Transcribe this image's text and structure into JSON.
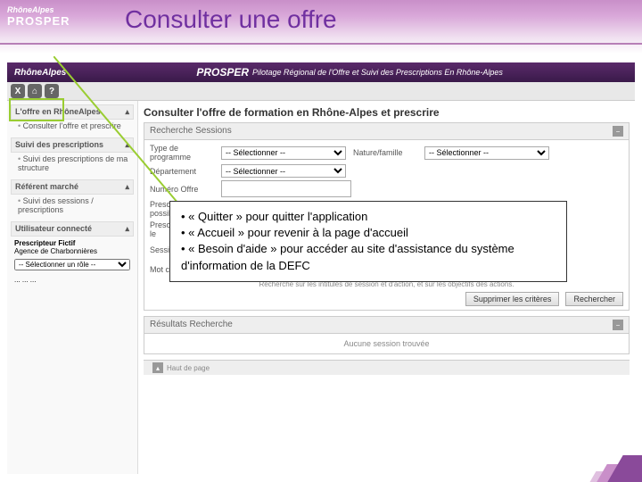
{
  "slide": {
    "brand_region": "RhôneAlpes",
    "brand_app": "PROSPER",
    "title": "Consulter une offre"
  },
  "app": {
    "header_region": "RhôneAlpes",
    "header_app": "PROSPER",
    "header_tagline": "Pilotage Régional de l'Offre et Suivi des Prescriptions En Rhône-Alpes",
    "topbuttons": {
      "quit": "X",
      "home": "⌂",
      "help": "?"
    }
  },
  "sidebar": {
    "s1": {
      "title": "L'offre en RhôneAlpes",
      "item1": "Consulter l'offre et prescrire"
    },
    "s2": {
      "title": "Suivi des prescriptions",
      "item1": "Suivi des prescriptions de ma structure"
    },
    "s3": {
      "title": "Référent marché",
      "item1": "Suivi des sessions / prescriptions"
    },
    "s4": {
      "title": "Utilisateur connecté",
      "name": "Prescripteur Fictif",
      "agency": "Agence de Charbonnières",
      "select": "-- Sélectionner un rôle --",
      "dots": "... ... ..."
    }
  },
  "main": {
    "title": "Consulter l'offre de formation en Rhône-Alpes et prescrire",
    "panel1_title": "Recherche Sessions",
    "labels": {
      "type_prog": "Type de programme",
      "nature": "Nature/famille",
      "dept": "Département",
      "num_offre": "Numéro Offre",
      "presc_possible": "Prescription possible",
      "presc_avant": "Prescription avant le",
      "session_apartir": "Session à partir du",
      "motcle": "Mot clé"
    },
    "select_default": "-- Sélectionner --",
    "hint": "Recherche sur les intitulés de session et d'action, et sur les objectifs des actions.",
    "btn_clear": "Supprimer les critères",
    "btn_search": "Rechercher",
    "panel2_title": "Résultats Recherche",
    "no_result": "Aucune session trouvée",
    "footer": "Haut de page"
  },
  "callout": {
    "l1": "• « Quitter » pour quitter l'application",
    "l2": "• « Accueil » pour revenir à la page d'accueil",
    "l3": "• « Besoin d'aide » pour accéder au site d'assistance du système d'information de la DEFC"
  }
}
